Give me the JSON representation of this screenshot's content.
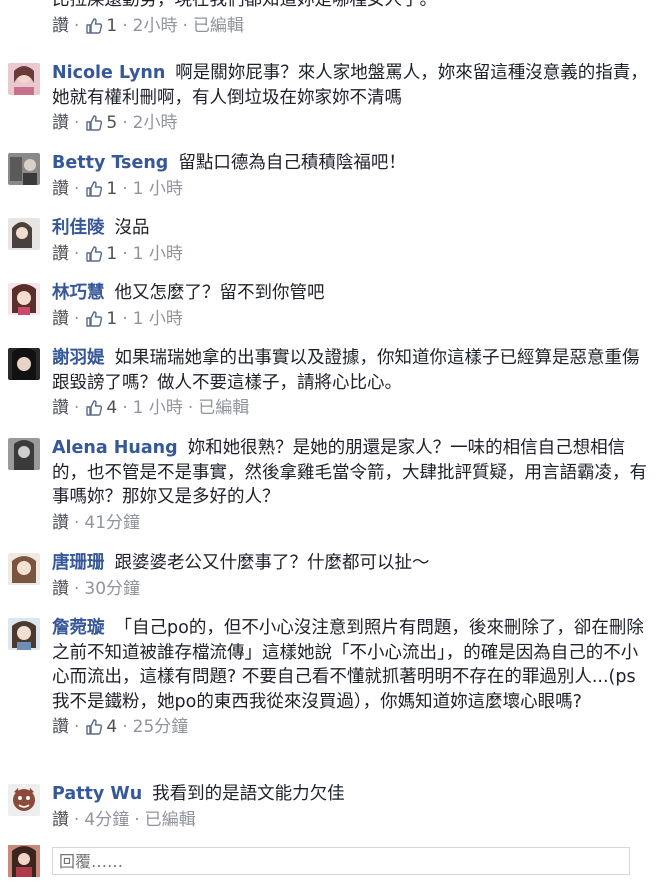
{
  "labels": {
    "like": "讚",
    "separator": "·",
    "edited": "已編輯",
    "reply_placeholder": "回覆……"
  },
  "comments": [
    {
      "name": "",
      "text": "比拉屎還勤勞，現在我們都知道妳是哪種女人了。",
      "likes": "1",
      "time": "2小時",
      "edited": true
    },
    {
      "name": "Nicole Lynn",
      "text": "啊是關妳屁事？來人家地盤罵人，妳來留這種沒意義的指責，她就有權利刪啊，有人倒垃圾在妳家妳不清嗎",
      "likes": "5",
      "time": "2小時",
      "edited": false
    },
    {
      "name": "Betty Tseng",
      "text": "留點口德為自己積積陰福吧！",
      "likes": "1",
      "time": "1 小時",
      "edited": false
    },
    {
      "name": "利佳陵",
      "text": "沒品",
      "likes": "1",
      "time": "1 小時",
      "edited": false
    },
    {
      "name": "林巧慧",
      "text": "他又怎麼了？留不到你管吧",
      "likes": "1",
      "time": "1 小時",
      "edited": false
    },
    {
      "name": "謝羽媞",
      "text": "如果瑞瑞她拿的出事實以及證據，你知道你這樣子已經算是惡意重傷跟毀謗了嗎？做人不要這樣子，請將心比心。",
      "likes": "4",
      "time": "1 小時",
      "edited": true
    },
    {
      "name": "Alena Huang",
      "text": "妳和她很熟？是她的朋還是家人？一味的相信自己想相信的，也不管是不是事實，然後拿雞毛當令箭，大肆批評質疑，用言語霸凌，有事嗎妳？那妳又是多好的人？",
      "likes": "",
      "time": "41分鐘",
      "edited": false
    },
    {
      "name": "唐珊珊",
      "text": "跟婆婆老公又什麼事了？什麼都可以扯～",
      "likes": "",
      "time": "30分鐘",
      "edited": false
    },
    {
      "name": "詹菀璇",
      "text": "「自己po的，但不小心沒注意到照片有問題，後來刪除了，卻在刪除之前不知道被誰存檔流傳」這樣她說「不小心流出」，的確是因為自己的不小心而流出，這樣有問題? 不要自己看不懂就抓著明明不存在的罪過別人...(ps我不是鐵粉，她po的東西我從來沒買過），你媽知道妳這麼壞心眼嗎?",
      "likes": "4",
      "time": "25分鐘",
      "edited": false
    },
    {
      "name": "Patty Wu",
      "text": "我看到的是語文能力欠佳",
      "likes": "",
      "time": "4分鐘",
      "edited": true
    }
  ],
  "colors": {
    "name": "#365899",
    "meta": "#90949c",
    "like_icon": "#5b6b8c"
  },
  "icons": [
    "thumbs-up-icon",
    "avatar"
  ]
}
